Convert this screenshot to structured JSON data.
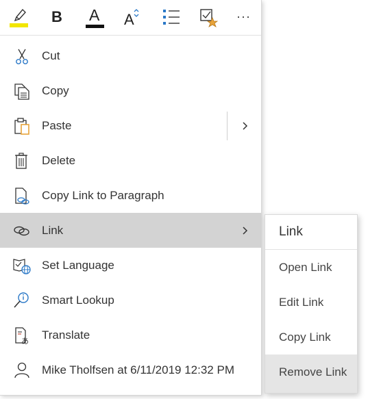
{
  "toolbar": {
    "buttons": [
      {
        "name": "highlight",
        "icon": "highlighter-icon",
        "color": "#f2e600"
      },
      {
        "name": "bold",
        "icon": "bold-icon",
        "label": "B"
      },
      {
        "name": "font-color",
        "icon": "font-color-icon",
        "label": "A",
        "color": "#000000"
      },
      {
        "name": "font-size",
        "icon": "font-size-icon",
        "label": "A"
      },
      {
        "name": "bullets",
        "icon": "bullet-list-icon",
        "color": "#2a78c7"
      },
      {
        "name": "tag",
        "icon": "to-do-tag-icon",
        "color": "#e8a33a"
      },
      {
        "name": "more",
        "icon": "ellipsis-icon",
        "label": "···"
      }
    ]
  },
  "menu": {
    "items": [
      {
        "label": "Cut",
        "icon": "scissors-icon"
      },
      {
        "label": "Copy",
        "icon": "copy-icon"
      },
      {
        "label": "Paste",
        "icon": "paste-icon"
      },
      {
        "label": "Delete",
        "icon": "trash-icon"
      },
      {
        "label": "Copy Link to Paragraph",
        "icon": "copy-link-icon"
      },
      {
        "label": "Link",
        "icon": "link-icon"
      },
      {
        "label": "Set Language",
        "icon": "language-icon"
      },
      {
        "label": "Smart Lookup",
        "icon": "smart-lookup-icon"
      },
      {
        "label": "Translate",
        "icon": "translate-icon"
      },
      {
        "label": "Mike Tholfsen at 6/11/2019 12:32 PM",
        "icon": "person-icon"
      }
    ],
    "highlighted": "Link"
  },
  "submenu": {
    "title": "Link",
    "items": [
      "Open Link",
      "Edit Link",
      "Copy Link",
      "Remove Link"
    ],
    "highlighted": "Remove Link"
  },
  "colors": {
    "highlight": "#d3d3d3",
    "accent_blue": "#2a78c7",
    "accent_orange": "#e8a33a"
  }
}
